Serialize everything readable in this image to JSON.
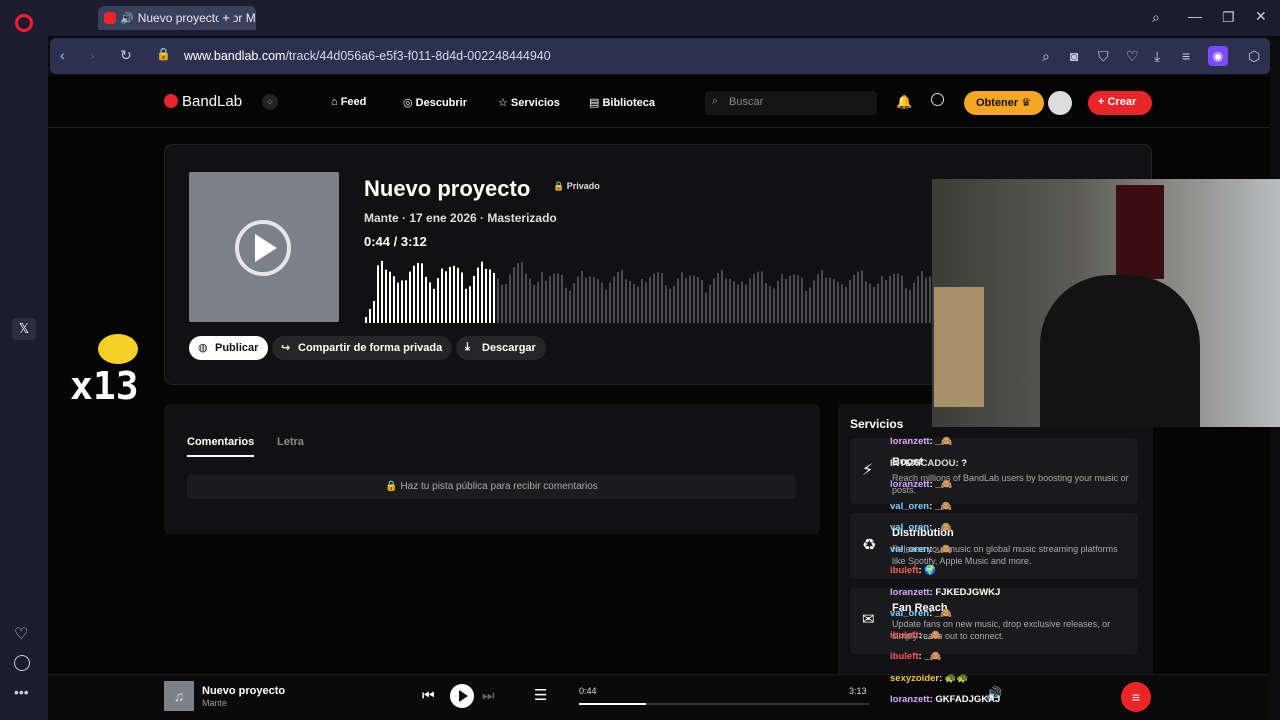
{
  "browser": {
    "tab_title": "Nuevo proyecto por M",
    "url_host": "www.bandlab.com",
    "url_path": "/track/44d056a6-e5f3-f011-8d4d-002248444940"
  },
  "nav": {
    "logo": "BandLab",
    "items": [
      "Feed",
      "Descubrir",
      "Servicios",
      "Biblioteca"
    ],
    "search_placeholder": "Buscar",
    "obtener_label": "Obtener",
    "crear_label": "Crear"
  },
  "track": {
    "title": "Nuevo proyecto",
    "privacy": "Privado",
    "meta": "Mante · 17 ene 2026 · Masterizado",
    "time": "0:44 / 3:12",
    "progress_fraction": 0.23,
    "actions": [
      "Publicar",
      "Compartir de forma privada",
      "Descargar"
    ]
  },
  "comments": {
    "tabs": [
      "Comentarios",
      "Letra"
    ],
    "notice": "Haz tu pista pública para recibir comentarios"
  },
  "services": {
    "heading": "Servicios",
    "items": [
      {
        "title": "Boost",
        "desc": "Reach millions of BandLab users by boosting your music or posts."
      },
      {
        "title": "Distribution",
        "desc": "Release your music on global music streaming platforms like Spotify, Apple Music and more."
      },
      {
        "title": "Fan Reach",
        "desc": "Update fans on new music, drop exclusive releases, or simply reach out to connect."
      }
    ]
  },
  "player": {
    "title": "Nuevo proyecto",
    "artist": "Mante",
    "current": "0:44",
    "total": "3:13",
    "progress_fraction": 0.23
  },
  "overlay": {
    "counter": "x13",
    "chat": [
      {
        "user": "loranzett",
        "msg": "_🙈",
        "color": "#d9a7ff"
      },
      {
        "user": "INTEXICADOU",
        "msg": "?",
        "color": "#dddddd"
      },
      {
        "user": "loranzett",
        "msg": "_🙈",
        "color": "#d9a7ff"
      },
      {
        "user": "val_oren",
        "msg": "_🙈",
        "color": "#7fd3ff"
      },
      {
        "user": "val_oren",
        "msg": "_🙈",
        "color": "#7fd3ff"
      },
      {
        "user": "val_oren",
        "msg": "_🙈",
        "color": "#7fd3ff"
      },
      {
        "user": "ibuleft",
        "msg": "🌍",
        "color": "#ff5a5a"
      },
      {
        "user": "loranzett",
        "msg": "FJKEDJGWKJ",
        "color": "#d9a7ff"
      },
      {
        "user": "val_oren",
        "msg": "_🙈",
        "color": "#7fd3ff"
      },
      {
        "user": "ibuleft",
        "msg": "_🙈",
        "color": "#ff5a5a"
      },
      {
        "user": "ibuleft",
        "msg": "_🙈",
        "color": "#ff5a5a"
      },
      {
        "user": "sexyzoider",
        "msg": "🐢🐢",
        "color": "#f5c542"
      },
      {
        "user": "loranzett",
        "msg": "GKFADJGKAJ",
        "color": "#d9a7ff"
      }
    ]
  },
  "colors": {
    "accent_red": "#e8262a",
    "accent_gold": "#f5a623",
    "page_bg": "#050505"
  }
}
